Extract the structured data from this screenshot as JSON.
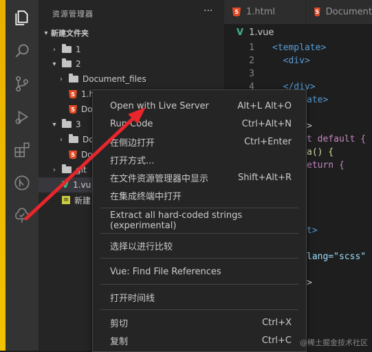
{
  "sidebar": {
    "title": "资源管理器",
    "more": "···",
    "root": "新建文件夹",
    "items": [
      {
        "label": "1"
      },
      {
        "label": "2"
      },
      {
        "label": "Document_files"
      },
      {
        "label": "1.h"
      },
      {
        "label": "Doc"
      },
      {
        "label": "3"
      },
      {
        "label": "Doc"
      },
      {
        "label": "Doc"
      },
      {
        "label": "git"
      },
      {
        "label": "1.vu"
      },
      {
        "label": "新建"
      }
    ]
  },
  "tabs": [
    {
      "label": "1.html"
    },
    {
      "label": "Document"
    }
  ],
  "breadcrumb": "1.vue",
  "code": {
    "line_numbers": [
      "1",
      "2",
      "3",
      "4",
      "5"
    ],
    "lines": [
      "<template>",
      "  <div>",
      "",
      "  </div>",
      "ate>",
      "",
      ">",
      "t default {",
      "a() {",
      "eturn {",
      "",
      "",
      "",
      "t>",
      "",
      "lang=\"scss\"",
      "",
      ">"
    ]
  },
  "menu": {
    "items": [
      {
        "label": "Open with Live Server",
        "shortcut": "Alt+L Alt+O"
      },
      {
        "label": "Run Code",
        "shortcut": "Ctrl+Alt+N"
      },
      {
        "label": "在侧边打开",
        "shortcut": "Ctrl+Enter"
      },
      {
        "label": "打开方式...",
        "shortcut": ""
      },
      {
        "label": "在文件资源管理器中显示",
        "shortcut": "Shift+Alt+R"
      },
      {
        "label": "在集成终端中打开",
        "shortcut": ""
      },
      {
        "label": "Extract all hard-coded strings (experimental)",
        "shortcut": ""
      },
      {
        "label": "选择以进行比较",
        "shortcut": ""
      },
      {
        "label": "Vue: Find File References",
        "shortcut": ""
      },
      {
        "label": "打开时间线",
        "shortcut": ""
      },
      {
        "label": "剪切",
        "shortcut": "Ctrl+X"
      },
      {
        "label": "复制",
        "shortcut": "Ctrl+C"
      }
    ]
  },
  "watermark": "@稀土掘金技术社区",
  "colors": {
    "annotation_arrow": "#e8262b",
    "accent_edge": "#f2c200"
  }
}
